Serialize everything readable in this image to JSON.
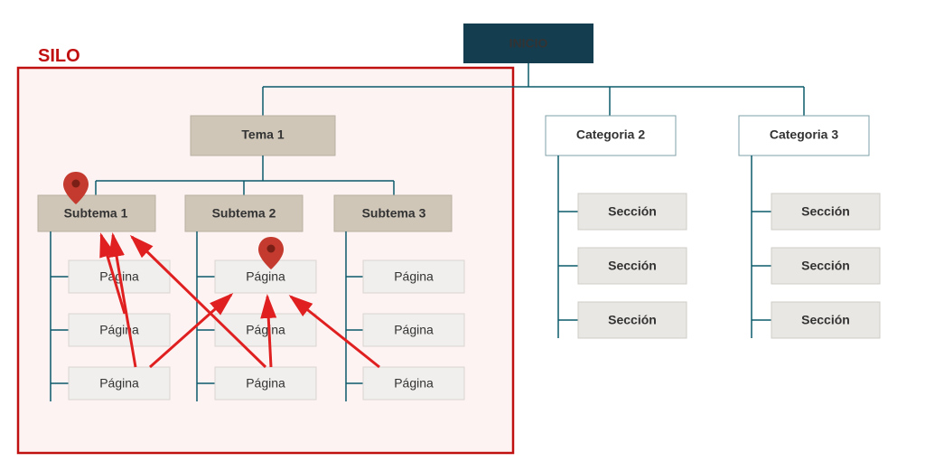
{
  "annotation": {
    "silo_label": "SILO"
  },
  "root": {
    "label": "INICIO"
  },
  "silo": {
    "theme": {
      "label": "Tema 1"
    },
    "sub1": {
      "label": "Subtema 1",
      "pages": [
        "Página",
        "Página",
        "Página"
      ]
    },
    "sub2": {
      "label": "Subtema 2",
      "pages": [
        "Página",
        "Página",
        "Página"
      ]
    },
    "sub3": {
      "label": "Subtema 3",
      "pages": [
        "Página",
        "Página",
        "Página"
      ]
    }
  },
  "cat2": {
    "label": "Categoria 2",
    "sections": [
      "Sección",
      "Sección",
      "Sección"
    ]
  },
  "cat3": {
    "label": "Categoria 3",
    "sections": [
      "Sección",
      "Sección",
      "Sección"
    ]
  },
  "colors": {
    "root_fill": "#143d4f",
    "root_text": "#ffffff",
    "theme_fill": "#cfc6b8",
    "theme_border": "#b9b0a2",
    "page_fill": "#f0efed",
    "page_border": "#d9d6d0",
    "cat_border": "#7fa0a8",
    "section_fill": "#e9e7e3",
    "silo_border": "#c01010",
    "silo_bg": "#fdf3f3",
    "conn": "#0b5b6b",
    "arrow": "#e02020",
    "pin": "#c43a2e"
  }
}
